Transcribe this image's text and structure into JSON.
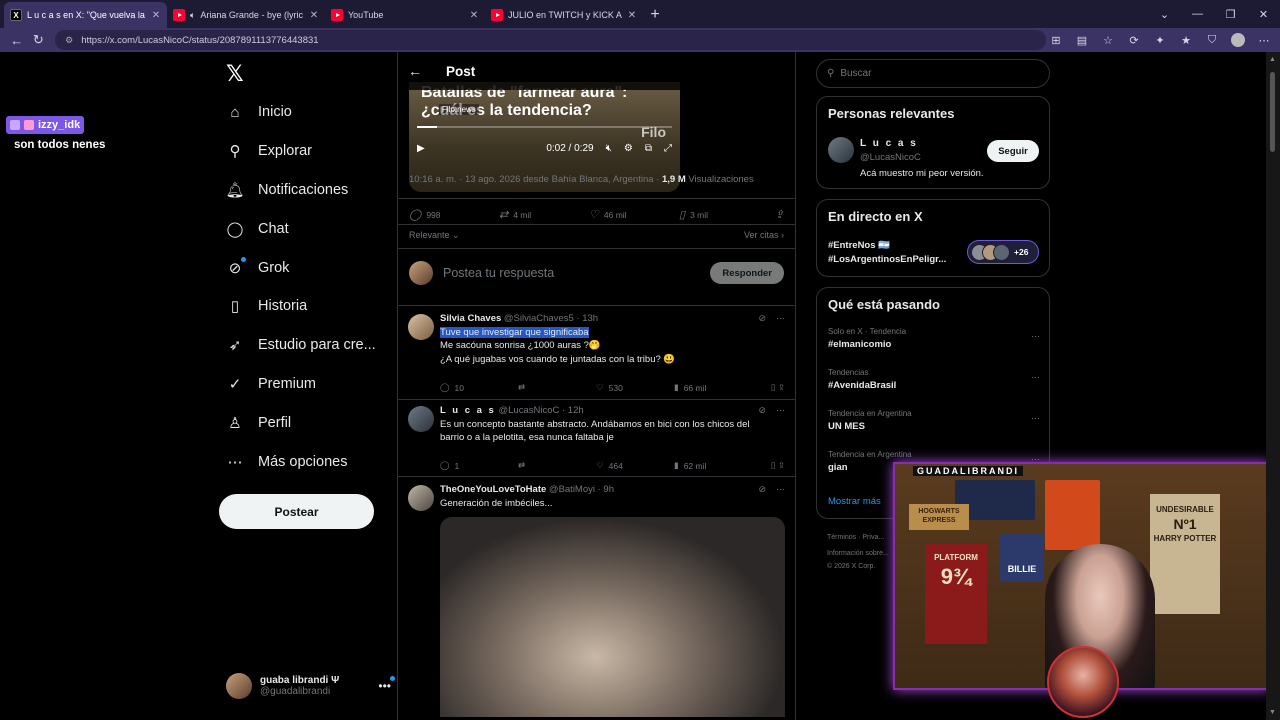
{
  "browser": {
    "tabs": [
      {
        "title": "L u c a s en X: \"Que vuelva la droga",
        "favicon": "x",
        "active": true
      },
      {
        "title": "Ariana Grande - bye (lyric visual",
        "favicon": "youtube-audio",
        "active": false
      },
      {
        "title": "YouTube",
        "favicon": "youtube",
        "active": false
      },
      {
        "title": "JULIO en TWITCH y KICK ARGENTI",
        "favicon": "youtube",
        "active": false
      }
    ],
    "url": "https://x.com/LucasNicoC/status/2087891113776443831"
  },
  "sidebar": {
    "logo": "𝕏",
    "items": [
      {
        "label": "Inicio",
        "icon": "home-icon",
        "glyph": "⌂"
      },
      {
        "label": "Explorar",
        "icon": "search-icon",
        "glyph": "⚲"
      },
      {
        "label": "Notificaciones",
        "icon": "bell-icon",
        "glyph": "🔔︎"
      },
      {
        "label": "Chat",
        "icon": "chat-icon",
        "glyph": "◯"
      },
      {
        "label": "Grok",
        "icon": "grok-icon",
        "glyph": "⊘"
      },
      {
        "label": "Historia",
        "icon": "bookmark-icon",
        "glyph": "▯"
      },
      {
        "label": "Estudio para cre...",
        "icon": "rocket-icon",
        "glyph": "➶"
      },
      {
        "label": "Premium",
        "icon": "verified-icon",
        "glyph": "✓"
      },
      {
        "label": "Perfil",
        "icon": "profile-icon",
        "glyph": "♙"
      },
      {
        "label": "Más opciones",
        "icon": "more-icon",
        "glyph": "⋯"
      }
    ],
    "post_button": "Postear",
    "account": {
      "name": "guaba librandi Ψ",
      "handle": "@guadalibrandi"
    }
  },
  "post": {
    "header_title": "Post",
    "video": {
      "headline": "Batallas de \"farmear aura\": ¿cuál es la tendencia?",
      "source": "Filo.news",
      "watermark": "Filo",
      "time": "0:02 / 0:29"
    },
    "meta_time": "10:16 a. m. · 13 ago. 2026 desde Bahía Blanca, Argentina · ",
    "meta_views_num": "1,9 M",
    "meta_views_label": " Visualizaciones",
    "actions": {
      "replies": "998",
      "reposts": "4 mil",
      "likes": "46 mil",
      "bookmarks": "3 mil"
    },
    "relevance": "Relevante",
    "quotes": "Ver citas",
    "reply_placeholder": "Postea tu respuesta",
    "reply_button": "Responder"
  },
  "replies": [
    {
      "name": "Silvia Chaves",
      "handle": "@SilviaChaves5 · 13h",
      "line1": "Tuve que investigar que significaba",
      "line2": "Me sacóuna sonrisa ¿1000 auras ?🤭",
      "line3": "¿A qué jugabas vos cuando te juntadas con la tribu? 😃",
      "stats": {
        "replies": "10",
        "likes": "530",
        "views": "66 mil"
      }
    },
    {
      "name": "L u c a s",
      "handle": "@LucasNicoC · 12h",
      "line1": "Es un concepto bastante abstracto. Andábamos en bici con los chicos del",
      "line2": "barrio o a la pelotita, esa nunca faltaba je",
      "stats": {
        "replies": "1",
        "likes": "464",
        "views": "62 mil"
      }
    },
    {
      "name": "TheOneYouLoveToHate",
      "handle": "@BatiMoyi · 9h",
      "line1": "Generación de imbéciles..."
    }
  ],
  "right": {
    "search_placeholder": "Buscar",
    "relevant": {
      "title": "Personas relevantes",
      "name": "L u c a s",
      "handle": "@LucasNicoC",
      "bio": "Acá muestro mi peor versión.",
      "follow": "Seguir"
    },
    "live": {
      "title": "En directo en X",
      "line1": "#EntreNos 🇦🇷",
      "line2": "#LosArgentinosEnPeligr...",
      "count": "+26"
    },
    "happening": {
      "title": "Qué está pasando",
      "trends": [
        {
          "context": "Solo en X · Tendencia",
          "name": "#elmanicomio"
        },
        {
          "context": "Tendencias",
          "name": "#AvenidaBrasil"
        },
        {
          "context": "Tendencia en Argentina",
          "name": "UN MES"
        },
        {
          "context": "Tendencia en Argentina",
          "name": "gian"
        }
      ],
      "more": "Mostrar más"
    },
    "footer": {
      "l1": "Términos  ·  Priva...",
      "l2": "Información sobre...",
      "l3": "© 2026 X Corp."
    }
  },
  "stream": {
    "chat_user": "izzy_idk",
    "chat_text": "son todos nenes",
    "cam_label": "GUADALIBRANDI",
    "poster_hogwarts": "HOGWARTS EXPRESS",
    "poster_platform": "PLATFORM",
    "poster_platform_num": "9¾",
    "poster_undesirable": "UNDESIRABLE",
    "poster_no1": "Nº1",
    "poster_harry": "HARRY POTTER",
    "poster_billie": "BILLIE"
  }
}
